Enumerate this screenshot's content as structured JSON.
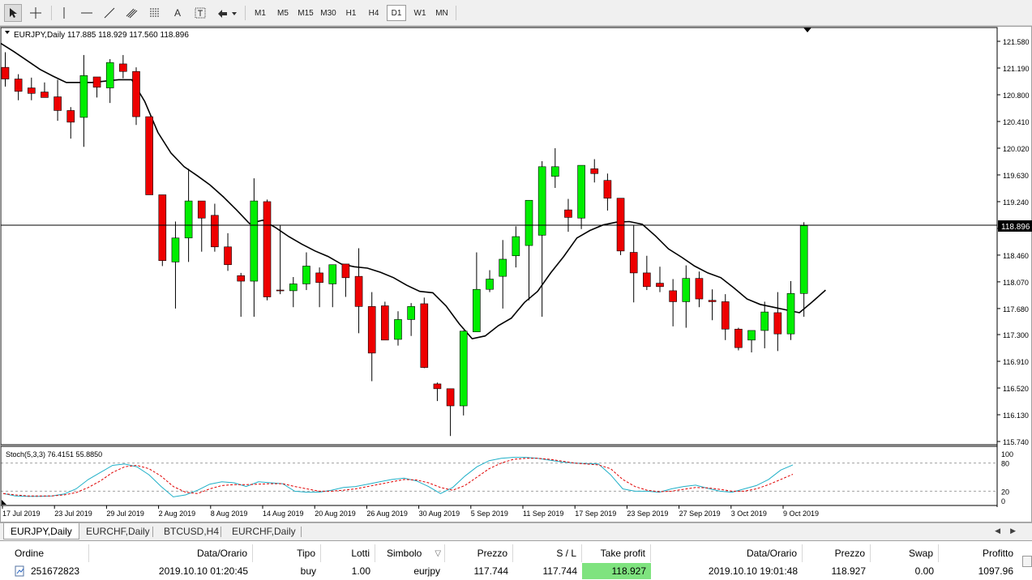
{
  "toolbar": {
    "timeframes": [
      "M1",
      "M5",
      "M15",
      "M30",
      "H1",
      "H4",
      "D1",
      "W1",
      "MN"
    ],
    "active_timeframe": "D1",
    "text_tool_label": "A"
  },
  "chart": {
    "header": "EURJPY,Daily  117.885 118.929 117.560 118.896",
    "current_price_label": "118.896",
    "indicator_label": "Stoch(5,3,3) 76.4151 55.8850",
    "colors": {
      "bull": "#00ee00",
      "bear": "#ee0000",
      "ma": "#000000",
      "stoch_main": "#20b0c8",
      "stoch_signal": "#e00000"
    }
  },
  "chart_data": {
    "type": "candlestick",
    "symbol": "EURJPY",
    "timeframe": "Daily",
    "ylim": [
      115.74,
      121.71
    ],
    "yticks": [
      "121.580",
      "121.190",
      "120.800",
      "120.410",
      "120.020",
      "119.630",
      "119.240",
      "118.850",
      "118.460",
      "118.070",
      "117.680",
      "117.300",
      "116.910",
      "116.520",
      "116.130",
      "115.740"
    ],
    "xticks": [
      "17 Jul 2019",
      "23 Jul 2019",
      "29 Jul 2019",
      "2 Aug 2019",
      "8 Aug 2019",
      "14 Aug 2019",
      "20 Aug 2019",
      "26 Aug 2019",
      "30 Aug 2019",
      "5 Sep 2019",
      "11 Sep 2019",
      "17 Sep 2019",
      "23 Sep 2019",
      "27 Sep 2019",
      "3 Oct 2019",
      "9 Oct 2019"
    ],
    "current_price": 118.896,
    "candles": [
      [
        121.2,
        121.42,
        120.92,
        121.03
      ],
      [
        121.03,
        121.1,
        120.72,
        120.85
      ],
      [
        120.9,
        121.05,
        120.72,
        120.82
      ],
      [
        120.84,
        120.98,
        120.76,
        120.76
      ],
      [
        120.77,
        121.02,
        120.42,
        120.57
      ],
      [
        120.57,
        120.62,
        120.16,
        120.4
      ],
      [
        120.47,
        121.38,
        120.04,
        121.08
      ],
      [
        121.06,
        121.02,
        120.76,
        120.91
      ],
      [
        120.9,
        121.32,
        120.68,
        121.27
      ],
      [
        121.25,
        121.38,
        121.04,
        121.14
      ],
      [
        121.14,
        121.2,
        120.36,
        120.48
      ],
      [
        120.48,
        120.46,
        119.34,
        119.34
      ],
      [
        119.34,
        119.34,
        118.3,
        118.38
      ],
      [
        118.36,
        118.95,
        117.68,
        118.71
      ],
      [
        118.71,
        119.72,
        118.36,
        119.25
      ],
      [
        119.25,
        119.25,
        118.51,
        119.0
      ],
      [
        119.04,
        119.21,
        118.51,
        118.58
      ],
      [
        118.58,
        118.78,
        118.23,
        118.32
      ],
      [
        118.16,
        118.2,
        117.56,
        118.08
      ],
      [
        118.08,
        119.58,
        117.56,
        119.25
      ],
      [
        119.24,
        119.27,
        117.8,
        117.85
      ],
      [
        117.95,
        118.89,
        117.89,
        117.94
      ],
      [
        117.94,
        118.14,
        117.7,
        118.04
      ],
      [
        118.04,
        118.5,
        117.95,
        118.3
      ],
      [
        118.2,
        118.28,
        117.7,
        118.06
      ],
      [
        118.04,
        118.25,
        117.7,
        118.32
      ],
      [
        118.33,
        118.24,
        117.85,
        118.13
      ],
      [
        118.15,
        118.56,
        117.32,
        117.71
      ],
      [
        117.71,
        117.92,
        116.62,
        117.03
      ],
      [
        117.72,
        117.78,
        117.25,
        117.22
      ],
      [
        117.23,
        117.64,
        117.14,
        117.52
      ],
      [
        117.52,
        117.76,
        117.28,
        117.71
      ],
      [
        117.75,
        117.84,
        116.81,
        116.82
      ],
      [
        116.58,
        116.6,
        116.33,
        116.51
      ],
      [
        116.51,
        116.51,
        115.82,
        116.26
      ],
      [
        116.26,
        117.36,
        116.12,
        117.35
      ],
      [
        117.34,
        118.5,
        117.34,
        117.96
      ],
      [
        117.96,
        118.24,
        117.92,
        118.11
      ],
      [
        118.15,
        118.68,
        117.68,
        118.4
      ],
      [
        118.45,
        118.88,
        118.28,
        118.73
      ],
      [
        118.6,
        118.96,
        117.8,
        119.26
      ],
      [
        118.75,
        119.83,
        117.56,
        119.75
      ],
      [
        119.61,
        120.02,
        119.44,
        119.75
      ],
      [
        119.12,
        119.28,
        118.8,
        119.01
      ],
      [
        119.0,
        119.77,
        118.84,
        119.77
      ],
      [
        119.72,
        119.86,
        119.52,
        119.65
      ],
      [
        119.55,
        119.65,
        119.11,
        119.29
      ],
      [
        119.29,
        119.29,
        118.46,
        118.52
      ],
      [
        118.5,
        118.9,
        117.77,
        118.2
      ],
      [
        118.2,
        118.45,
        117.95,
        118.0
      ],
      [
        118.05,
        118.29,
        117.92,
        118.0
      ],
      [
        117.94,
        118.11,
        117.42,
        117.78
      ],
      [
        117.78,
        118.31,
        117.4,
        118.12
      ],
      [
        118.12,
        118.22,
        117.7,
        117.82
      ],
      [
        117.8,
        117.96,
        117.51,
        117.78
      ],
      [
        117.78,
        117.89,
        117.22,
        117.38
      ],
      [
        117.38,
        117.4,
        117.07,
        117.11
      ],
      [
        117.22,
        117.24,
        117.04,
        117.36
      ],
      [
        117.36,
        117.78,
        117.1,
        117.63
      ],
      [
        117.62,
        117.92,
        117.06,
        117.31
      ],
      [
        117.31,
        118.08,
        117.22,
        117.9
      ],
      [
        117.9,
        118.94,
        117.56,
        118.89
      ]
    ],
    "ma_close": [
      121.55,
      121.43,
      121.3,
      121.17,
      121.07,
      120.98,
      120.98,
      120.98,
      121.0,
      121.02,
      121.02,
      120.7,
      120.25,
      119.95,
      119.75,
      119.62,
      119.48,
      119.31,
      119.12,
      118.92,
      118.97,
      118.86,
      118.73,
      118.62,
      118.52,
      118.44,
      118.33,
      118.29,
      118.27,
      118.21,
      118.13,
      118.02,
      117.93,
      117.91,
      117.72,
      117.46,
      117.24,
      117.28,
      117.43,
      117.54,
      117.77,
      117.93,
      118.2,
      118.44,
      118.71,
      118.82,
      118.9,
      118.94,
      118.95,
      118.91,
      118.74,
      118.55,
      118.43,
      118.3,
      118.2,
      118.13,
      117.98,
      117.82,
      117.74,
      117.7,
      117.66,
      117.62,
      117.78,
      117.95
    ],
    "stoch": {
      "ylim": [
        0,
        100
      ],
      "levels": [
        20,
        80
      ],
      "labels": [
        "100",
        "80",
        "20",
        "0"
      ],
      "main": [
        15,
        10,
        9,
        9,
        10,
        14,
        25,
        45,
        60,
        75,
        78,
        72,
        55,
        30,
        8,
        12,
        22,
        35,
        40,
        38,
        30,
        40,
        38,
        36,
        20,
        18,
        18,
        22,
        28,
        30,
        35,
        40,
        45,
        48,
        42,
        30,
        15,
        28,
        52,
        72,
        85,
        90,
        92,
        92,
        90,
        86,
        82,
        80,
        79,
        78,
        55,
        25,
        20,
        20,
        18,
        25,
        30,
        33,
        26,
        20,
        18,
        25,
        32,
        45,
        65,
        76
      ],
      "signal": [
        15,
        12,
        10,
        10,
        10,
        12,
        17,
        28,
        42,
        60,
        72,
        75,
        68,
        52,
        30,
        18,
        15,
        25,
        32,
        34,
        34,
        35,
        36,
        36,
        30,
        25,
        20,
        20,
        22,
        25,
        30,
        35,
        40,
        45,
        44,
        38,
        28,
        22,
        32,
        50,
        68,
        80,
        88,
        90,
        90,
        88,
        84,
        80,
        78,
        76,
        68,
        45,
        30,
        22,
        19,
        20,
        24,
        28,
        27,
        24,
        20,
        20,
        25,
        34,
        45,
        56
      ]
    }
  },
  "tabs": {
    "items": [
      "EURJPY,Daily",
      "EURCHF,Daily",
      "BTCUSD,H4",
      "EURCHF,Daily"
    ],
    "active": 0
  },
  "terminal": {
    "headers": [
      "Ordine",
      "Data/Orario",
      "Tipo",
      "Lotti",
      "Simbolo",
      "Prezzo",
      "S / L",
      "Take profit",
      "Data/Orario",
      "Prezzo",
      "Swap",
      "Profitto"
    ],
    "sort_indicator": "▽",
    "row": {
      "order": "251672823",
      "open_time": "2019.10.10 01:20:45",
      "type": "buy",
      "lots": "1.00",
      "symbol": "eurjpy",
      "open_price": "117.744",
      "sl": "117.744",
      "tp": "118.927",
      "time": "2019.10.10 19:01:48",
      "price": "118.927",
      "swap": "0.00",
      "profit": "1097.96"
    },
    "tp_highlight_color": "#7fe37f"
  }
}
